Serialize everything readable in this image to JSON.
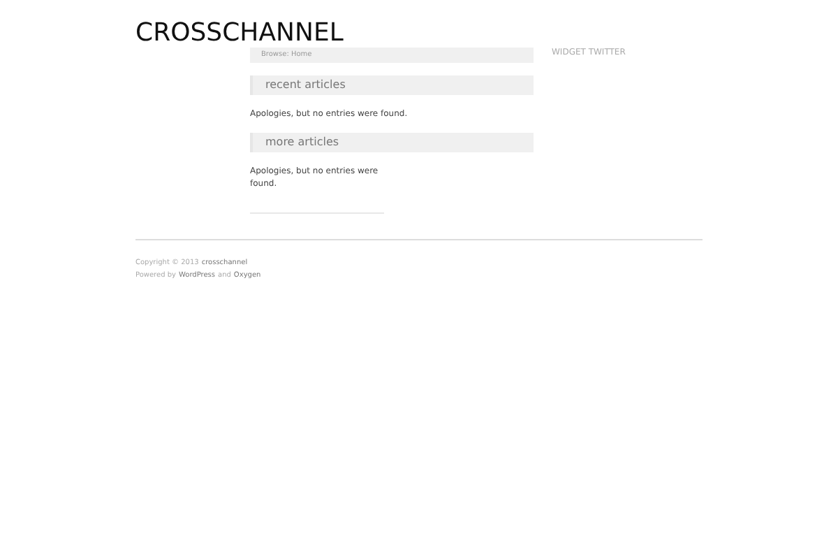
{
  "site_title": "CROSSCHANNEL",
  "breadcrumb": "Browse: Home",
  "sections": [
    {
      "heading": "recent articles",
      "message": "Apologies, but no entries were found.",
      "kind": "wide"
    },
    {
      "heading": "more articles",
      "message": "Apologies, but no entries were found.",
      "kind": "narrow"
    }
  ],
  "sidebar": {
    "widget_title": "WIDGET TWITTER"
  },
  "footer": {
    "copyright": "Copyright © 2013",
    "site_link": "crosschannel",
    "powered_prefix": "Powered by",
    "link_1": "WordPress",
    "joiner": "and",
    "link_2": "Oxygen"
  }
}
